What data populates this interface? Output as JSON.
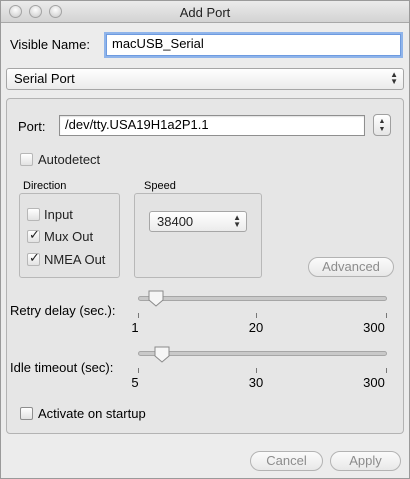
{
  "window": {
    "title": "Add Port"
  },
  "visible_name": {
    "label": "Visible Name:",
    "value": "macUSB_Serial"
  },
  "port_type": {
    "selected": "Serial Port"
  },
  "port": {
    "label": "Port:",
    "value": "/dev/tty.USA19H1a2P1.1"
  },
  "autodetect": {
    "label": "Autodetect",
    "checked": false
  },
  "direction": {
    "title": "Direction",
    "items": [
      {
        "label": "Input",
        "checked": false
      },
      {
        "label": "Mux Out",
        "checked": true
      },
      {
        "label": "NMEA Out",
        "checked": true
      }
    ]
  },
  "speed": {
    "title": "Speed",
    "selected": "38400"
  },
  "advanced_label": "Advanced",
  "retry_delay": {
    "label": "Retry delay (sec.):",
    "min": 1,
    "max": 300,
    "value": 20,
    "tick_labels": [
      "1",
      "20",
      "300"
    ]
  },
  "idle_timeout": {
    "label": "Idle timeout (sec):",
    "min": 5,
    "max": 300,
    "value": 30,
    "tick_labels": [
      "5",
      "30",
      "300"
    ]
  },
  "activate_on_startup": {
    "label": "Activate on startup",
    "checked": false
  },
  "buttons": {
    "cancel": "Cancel",
    "apply": "Apply"
  }
}
